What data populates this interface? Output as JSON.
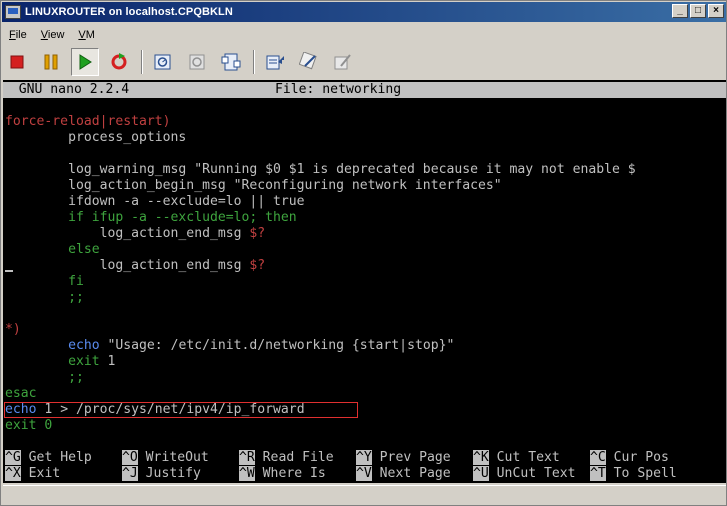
{
  "window": {
    "title": "LINUXROUTER on localhost.CPQBKLN"
  },
  "caption_buttons": {
    "minimize": "_",
    "maximize": "□",
    "close": "×"
  },
  "menu": [
    {
      "label": "File",
      "u": "F",
      "rest": "ile"
    },
    {
      "label": "View",
      "u": "V",
      "rest": "iew"
    },
    {
      "label": "VM",
      "u": "V",
      "rest": "M"
    }
  ],
  "colors": {
    "stop": "#d42020",
    "pause": "#e0a000",
    "play": "#20a020",
    "reset": "#d42020"
  },
  "nano": {
    "version": "  GNU nano 2.2.4",
    "file": "File: networking"
  },
  "code": [
    {
      "text": "force-reload|restart)",
      "cls": "red"
    },
    {
      "text": "        process_options",
      "cls": ""
    },
    {
      "text": "",
      "cls": ""
    },
    {
      "text": "        log_warning_msg \"Running $0 $1 is deprecated because it may not enable $",
      "cls": ""
    },
    {
      "text": "        log_action_begin_msg \"Reconfiguring network interfaces\"",
      "cls": ""
    },
    {
      "text": "        ifdown -a --exclude=lo || true",
      "cls": ""
    },
    {
      "text": "        if ifup -a --exclude=lo; then",
      "cls": ""
    },
    {
      "text": "            log_action_end_msg $?",
      "cls": ""
    },
    {
      "text": "        else",
      "cls": ""
    },
    {
      "text": "            log_action_end_msg $?",
      "cls": ""
    },
    {
      "text": "        fi",
      "cls": ""
    },
    {
      "text": "        ;;",
      "cls": ""
    },
    {
      "text": "",
      "cls": ""
    },
    {
      "text": "*)",
      "cls": ""
    },
    {
      "text": "        echo \"Usage: /etc/init.d/networking {start|stop}\"",
      "cls": ""
    },
    {
      "text": "        exit 1",
      "cls": ""
    },
    {
      "text": "        ;;",
      "cls": ""
    },
    {
      "text": "esac",
      "cls": ""
    },
    {
      "text": "echo 1 > /proc/sys/net/ipv4/ip_forward",
      "cls": ""
    },
    {
      "text": "exit 0",
      "cls": ""
    }
  ],
  "shortcuts_row1": [
    {
      "key": "^G",
      "label": "Get Help"
    },
    {
      "key": "^O",
      "label": "WriteOut"
    },
    {
      "key": "^R",
      "label": "Read File"
    },
    {
      "key": "^Y",
      "label": "Prev Page"
    },
    {
      "key": "^K",
      "label": "Cut Text"
    },
    {
      "key": "^C",
      "label": "Cur Pos"
    }
  ],
  "shortcuts_row2": [
    {
      "key": "^X",
      "label": "Exit"
    },
    {
      "key": "^J",
      "label": "Justify"
    },
    {
      "key": "^W",
      "label": "Where Is"
    },
    {
      "key": "^V",
      "label": "Next Page"
    },
    {
      "key": "^U",
      "label": "UnCut Text"
    },
    {
      "key": "^T",
      "label": "To Spell"
    }
  ]
}
